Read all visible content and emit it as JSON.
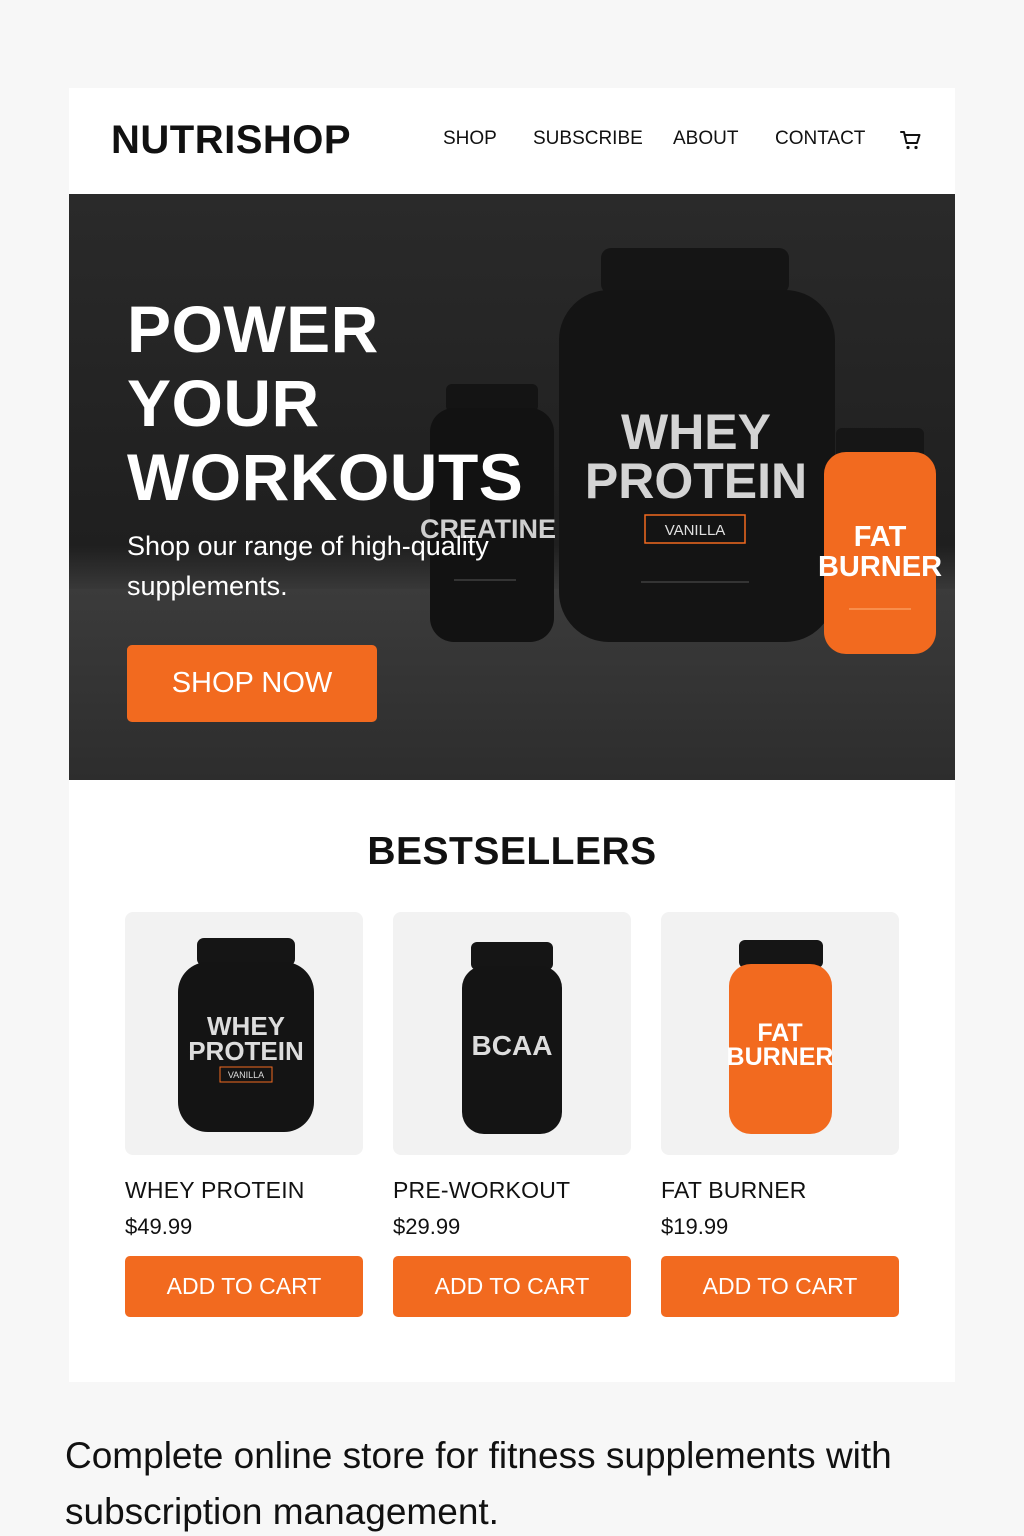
{
  "header": {
    "logo": "NUTRISHOP",
    "nav": [
      "SHOP",
      "SUBSCRIBE",
      "ABOUT",
      "CONTACT"
    ],
    "cart_icon": "cart-icon"
  },
  "hero": {
    "title_lines": [
      "POWER",
      "YOUR",
      "WORKOUTS"
    ],
    "subtitle": "Shop our range of high-quality supplements.",
    "cta": "SHOP NOW",
    "products": {
      "creatine_label": "CREATINE",
      "whey_label_1": "WHEY",
      "whey_label_2": "PROTEIN",
      "whey_flavor": "VANILLA",
      "fatburner_label_1": "FAT",
      "fatburner_label_2": "BURNER"
    }
  },
  "bestsellers": {
    "title": "BESTSELLERS",
    "products": [
      {
        "name": "WHEY PROTEIN",
        "price": "$49.99",
        "button": "ADD TO CART",
        "jar_line1": "WHEY",
        "jar_line2": "PROTEIN",
        "jar_flavor": "VANILLA"
      },
      {
        "name": "PRE-WORKOUT",
        "price": "$29.99",
        "button": "ADD TO CART",
        "jar_line1": "BCAA"
      },
      {
        "name": "FAT BURNER",
        "price": "$19.99",
        "button": "ADD TO CART",
        "jar_line1": "FAT",
        "jar_line2": "BURNER"
      }
    ]
  },
  "caption": "Complete online store for fitness supplements with subscription management.",
  "colors": {
    "accent": "#f26a1f",
    "hero_bg": "#1f1f1f",
    "text": "#111111"
  }
}
